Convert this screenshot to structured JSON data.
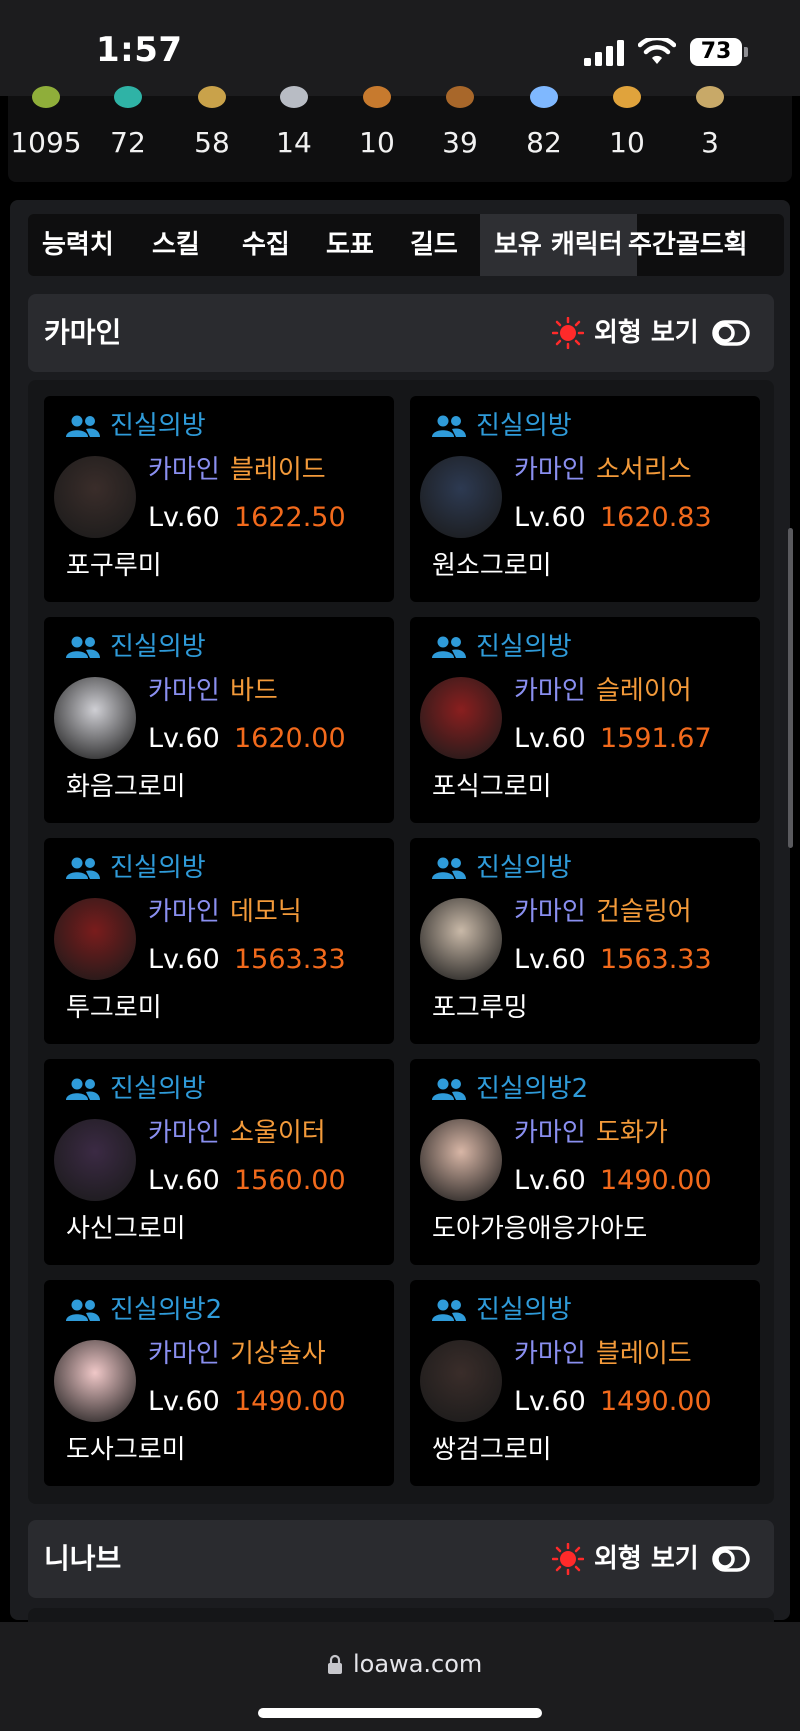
{
  "status_bar": {
    "time": "1:57",
    "battery": "73"
  },
  "inventory": {
    "items": [
      {
        "icon": "green-orb-icon",
        "count": "1095",
        "color": "#8fae3a"
      },
      {
        "icon": "teal-crystal-icon",
        "count": "72",
        "color": "#2fb3a6"
      },
      {
        "icon": "gold-ingot-icon",
        "count": "58",
        "color": "#c9a24a"
      },
      {
        "icon": "silver-ore-icon",
        "count": "14",
        "color": "#b8bcc4"
      },
      {
        "icon": "blue-shield-icon",
        "count": "10",
        "color": "#c77a2e"
      },
      {
        "icon": "bronze-fragment-icon",
        "count": "39",
        "color": "#a8672a"
      },
      {
        "icon": "blue-star-icon",
        "count": "82",
        "color": "#7fb8ff"
      },
      {
        "icon": "orange-star-icon",
        "count": "10",
        "color": "#e0a33c"
      },
      {
        "icon": "gold-coin-icon",
        "count": "3",
        "color": "#c8a968"
      }
    ]
  },
  "tabs": [
    {
      "label": "능력치",
      "active": false
    },
    {
      "label": "스킬",
      "active": false
    },
    {
      "label": "수집",
      "active": false
    },
    {
      "label": "도표",
      "active": false
    },
    {
      "label": "길드",
      "active": false
    },
    {
      "label": "보유 캐릭터",
      "active": true
    },
    {
      "label": "주간골드획",
      "active": false
    }
  ],
  "servers": [
    {
      "title": "카마인",
      "appearance_label": "외형 보기",
      "characters": [
        {
          "guild": "진실의방",
          "server": "카마인",
          "class": "블레이드",
          "level": "Lv.60",
          "item_level": "1622.50",
          "name": "포구루미",
          "avatar_color": "#3a2d2a"
        },
        {
          "guild": "진실의방",
          "server": "카마인",
          "class": "소서리스",
          "level": "Lv.60",
          "item_level": "1620.83",
          "name": "원소그로미",
          "avatar_color": "#2d3a52"
        },
        {
          "guild": "진실의방",
          "server": "카마인",
          "class": "바드",
          "level": "Lv.60",
          "item_level": "1620.00",
          "name": "화음그로미",
          "avatar_color": "#cfcfd4"
        },
        {
          "guild": "진실의방",
          "server": "카마인",
          "class": "슬레이어",
          "level": "Lv.60",
          "item_level": "1591.67",
          "name": "포식그로미",
          "avatar_color": "#8a1f1f"
        },
        {
          "guild": "진실의방",
          "server": "카마인",
          "class": "데모닉",
          "level": "Lv.60",
          "item_level": "1563.33",
          "name": "투그로미",
          "avatar_color": "#7a1c1c"
        },
        {
          "guild": "진실의방",
          "server": "카마인",
          "class": "건슬링어",
          "level": "Lv.60",
          "item_level": "1563.33",
          "name": "포그루밍",
          "avatar_color": "#c9b9a8"
        },
        {
          "guild": "진실의방",
          "server": "카마인",
          "class": "소울이터",
          "level": "Lv.60",
          "item_level": "1560.00",
          "name": "사신그로미",
          "avatar_color": "#3b2a44"
        },
        {
          "guild": "진실의방2",
          "server": "카마인",
          "class": "도화가",
          "level": "Lv.60",
          "item_level": "1490.00",
          "name": "도아가응애응가아도",
          "avatar_color": "#d8b6a6"
        },
        {
          "guild": "진실의방2",
          "server": "카마인",
          "class": "기상술사",
          "level": "Lv.60",
          "item_level": "1490.00",
          "name": "도사그로미",
          "avatar_color": "#f0c8c8"
        },
        {
          "guild": "진실의방",
          "server": "카마인",
          "class": "블레이드",
          "level": "Lv.60",
          "item_level": "1490.00",
          "name": "쌍검그로미",
          "avatar_color": "#3a2d2a"
        }
      ]
    },
    {
      "title": "니나브",
      "appearance_label": "외형 보기",
      "characters": []
    }
  ],
  "browser": {
    "url": "loawa.com"
  },
  "colors": {
    "guild": "#2f9bd9",
    "server": "#8a8ff0",
    "class": "#f39a3a",
    "item_level": "#f26a1c",
    "sun": "#ff2a2a"
  }
}
